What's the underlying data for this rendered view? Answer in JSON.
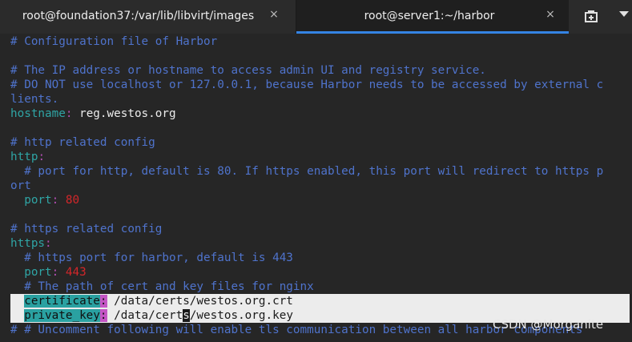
{
  "tabs": [
    {
      "title": "root@foundation37:/var/lib/libvirt/images",
      "close": "×",
      "active": false
    },
    {
      "title": "root@server1:~/harbor",
      "close": "×",
      "active": true
    }
  ],
  "tab_buttons": {
    "new_tab_icon": "new-tab-icon",
    "menu_icon": "chevron-down-icon"
  },
  "terminal": {
    "lines": [
      "# Configuration file of Harbor",
      "",
      "# The IP address or hostname to access admin UI and registry service.",
      "# DO NOT use localhost or 127.0.0.1, because Harbor needs to be accessed by external c",
      "lients.",
      {
        "key": "hostname",
        "sep": ":",
        "value": " reg.westos.org"
      },
      "",
      "# http related config",
      {
        "key": "http",
        "sep": ":"
      },
      "  # port for http, default is 80. If https enabled, this port will redirect to https p",
      "ort",
      {
        "indent": "  ",
        "key": "port",
        "sep": ":",
        "num": " 80"
      },
      "",
      "# https related config",
      {
        "key": "https",
        "sep": ":"
      },
      "  # https port for harbor, default is 443",
      {
        "indent": "  ",
        "key": "port",
        "sep": ":",
        "num": " 443"
      },
      "  # The path of cert and key files for nginx",
      {
        "indent": "  ",
        "key": "certificate",
        "sep": ":",
        "value": " /data/certs/westos.org.crt",
        "highlight": true
      },
      {
        "indent": "  ",
        "key": "private_key",
        "sep": ":",
        "value_pre": " /data/cert",
        "cursor_char": "s",
        "value_post": "/westos.org.key",
        "highlight": true
      },
      "# # Uncomment following will enable tls communication between all harbor components"
    ]
  },
  "watermark": "CSDN @Morganite",
  "colors": {
    "background": "#262626",
    "comment": "#4f73cc",
    "key": "#2fa5a5",
    "number": "#d3262a",
    "active_tab_underline": "#3584e4"
  }
}
